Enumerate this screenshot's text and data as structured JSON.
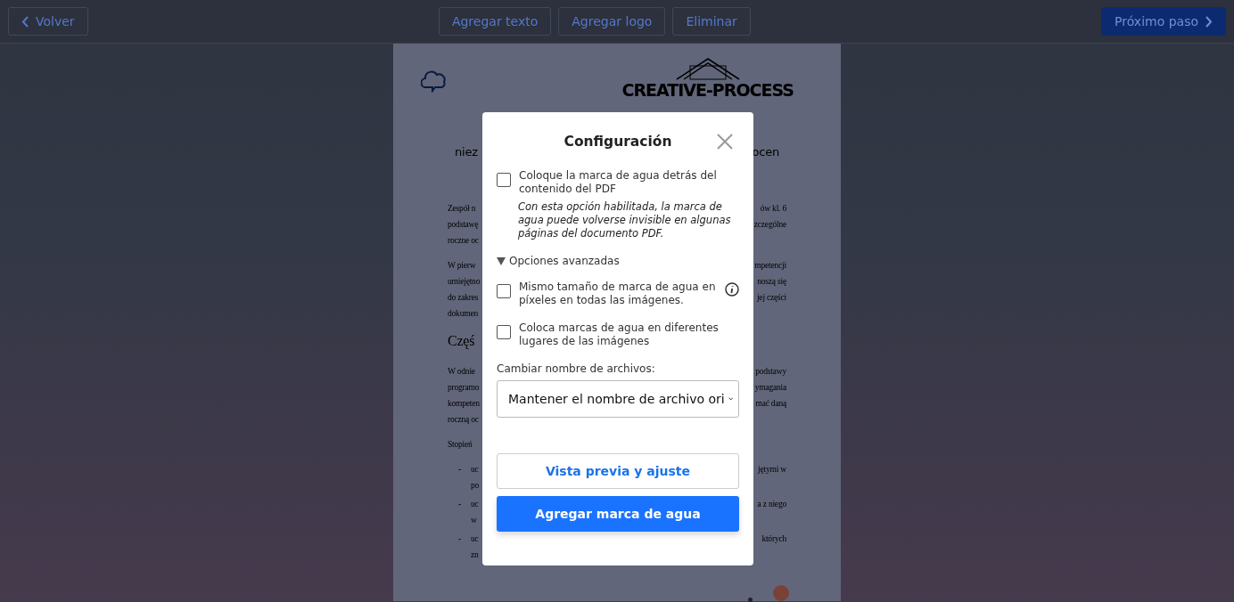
{
  "toolbar": {
    "back_button": "Volver",
    "actions": [
      "Agregar texto",
      "Agregar logo",
      "Eliminar"
    ],
    "next_button": "Próximo paso"
  },
  "document": {
    "logo_text": "CREATIVE-PROCESS",
    "blocks": [
      {
        "kind": "subtitle",
        "lines": [
          {
            "left": "niez",
            "right": "ocen"
          }
        ]
      },
      {
        "kind": "paragraph",
        "lines": [
          {
            "left": "Zespół n",
            "right": "ów kl. 6"
          },
          {
            "left": "podstawę",
            "right": "zczególne"
          },
          {
            "left": "roczne oc"
          }
        ]
      },
      {
        "kind": "paragraph",
        "lines": [
          {
            "left": "W pierw",
            "right": "mpetencji"
          },
          {
            "left": "umiejętno",
            "right": "noszą się"
          },
          {
            "left": "do zakres",
            "right": "jej części"
          },
          {
            "left": "dokumen"
          }
        ]
      },
      {
        "kind": "heading",
        "lines": [
          {
            "left": "Częś"
          }
        ]
      },
      {
        "kind": "paragraph",
        "lines": [
          {
            "left": "W odnie",
            "right": "podstawy"
          },
          {
            "left": "programo",
            "right": "ymagania"
          },
          {
            "left": "kompeten",
            "right": "mać daną"
          },
          {
            "left": "roczną oc"
          }
        ]
      },
      {
        "kind": "paragraph",
        "lines": [
          {
            "left": "Stopień"
          }
        ]
      },
      {
        "kind": "list",
        "items": [
          {
            "marker": "-",
            "lines": [
              {
                "left": "uc",
                "right": "jętymi w"
              },
              {
                "left": "po"
              }
            ]
          },
          {
            "marker": "-",
            "lines": [
              {
                "left": "uc",
                "right": "a z niego"
              },
              {
                "left": "w"
              }
            ]
          },
          {
            "marker": "-",
            "lines": [
              {
                "left": "uc",
                "right": "których"
              },
              {
                "left": "zn"
              }
            ]
          }
        ]
      }
    ]
  },
  "dialog": {
    "title": "Configuración",
    "options": [
      {
        "label": "Coloque la marca de agua detrás del contenido del PDF",
        "checked": false,
        "note": "Con esta opción habilitada, la marca de agua puede volverse invisible en algunas páginas del documento PDF."
      }
    ],
    "advanced": {
      "label": "Opciones avanzadas",
      "expanded": true,
      "options": [
        {
          "label": "Mismo tamaño de marca de agua en píxeles en todas las imágenes.",
          "checked": false,
          "info": true
        },
        {
          "label": "Coloca marcas de agua en diferentes lugares de las imágenes",
          "checked": false,
          "info": false
        }
      ]
    },
    "rename_label": "Cambiar nombre de archivos:",
    "rename_value": "Mantener el nombre de archivo ori",
    "preview_button": "Vista previa y ajuste",
    "submit_button": "Agregar marca de agua"
  }
}
